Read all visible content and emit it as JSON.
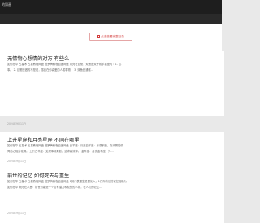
{
  "window": {
    "title": "的知画"
  },
  "action_button": {
    "label": "点击查看完整目录",
    "icon": "document-icon"
  },
  "articles": [
    {
      "title": "无情物心想情的对方 有些么",
      "excerpt_line1": "如何在华 占星术 占星教程网盘 塔罗牌教程百度网盘 月亮在巨蟹，双鱼座双子射手星座时：1. 心",
      "excerpt_line2": "事。 2. 巨蟹座做的不是说，感应在你喜爱的人或事物。 3. 双鱼座通常…",
      "date": "2024年9月11日"
    },
    {
      "title": "上升星座和月亮星座 不同在哪里",
      "excerpt_line1": "如何在华 占星术 占星教程网盘 塔罗牌教程百度网盘 白羊座：月亮白羊座：乐观积极，喜欢冒险精",
      "excerpt_line2": "同他心相对较弱。 上升白羊座：处理事情果断，追求高效率。 金牛座：月亮金牛座：外…",
      "date": "2024年9月11日"
    },
    {
      "title": "前世的记忆 如何死去与重生",
      "excerpt_line1": "如何在华 占星术 占星教程网盘 塔罗牌教程百度网盘 1到代表重生是暂化入，1万你前世的记忆相助为",
      "excerpt_line2": "如何在华 太阳在八宫：前世可能是一个富有潜力和权势的人物，在人们的记忆…",
      "date": "2024年9月11日"
    }
  ]
}
